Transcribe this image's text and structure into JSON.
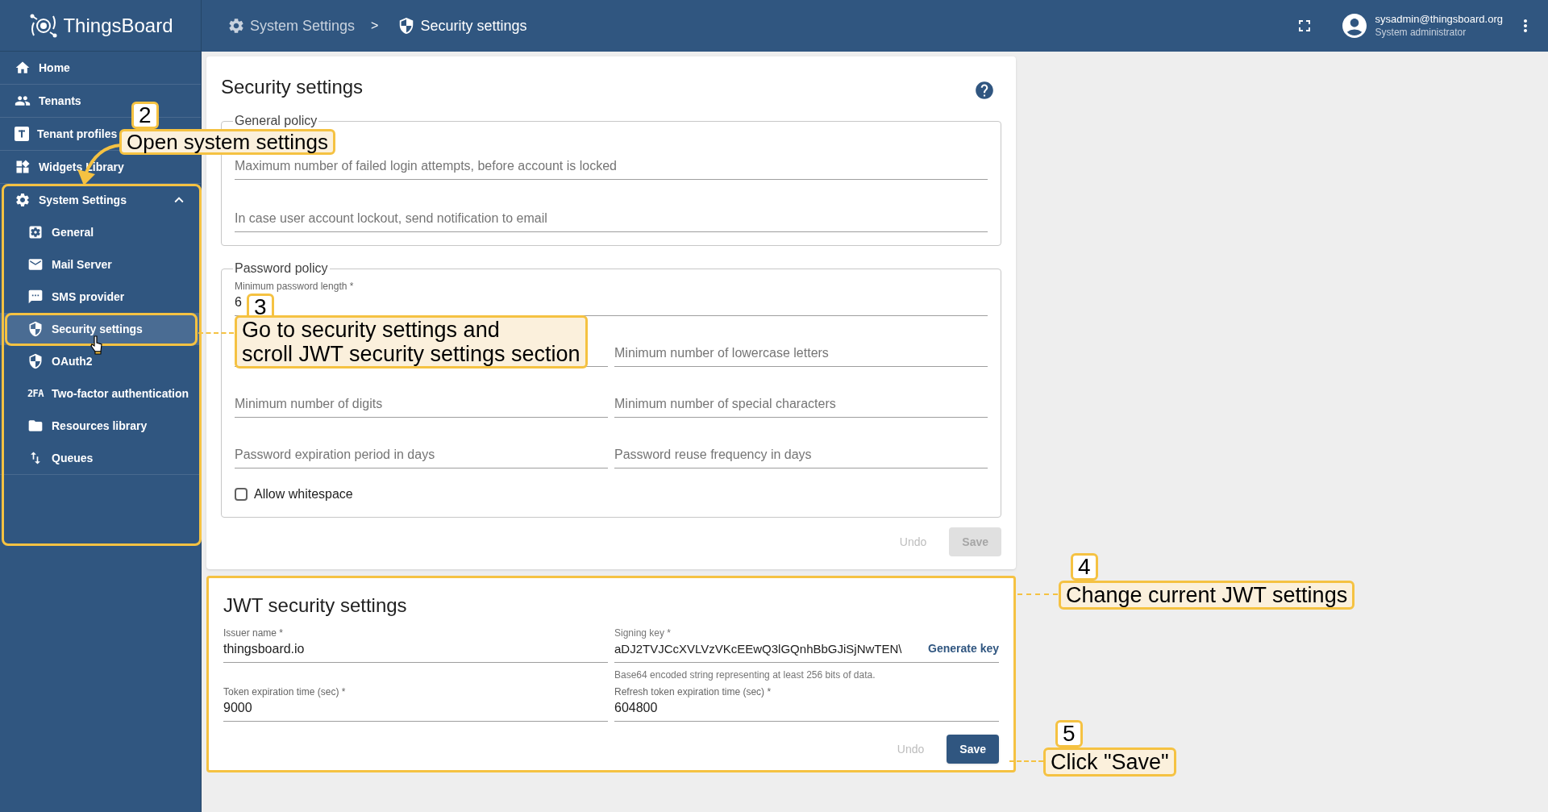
{
  "app": {
    "logo": "ThingsBoard"
  },
  "breadcrumb": {
    "parent": "System Settings",
    "separator": ">",
    "current": "Security settings"
  },
  "user": {
    "email": "sysadmin@thingsboard.org",
    "role": "System administrator"
  },
  "sidebar": {
    "items": [
      {
        "label": "Home",
        "selected": false
      },
      {
        "label": "Tenants",
        "selected": false
      },
      {
        "label": "Tenant profiles",
        "selected": false
      },
      {
        "label": "Widgets Library",
        "selected": false
      },
      {
        "label": "System Settings",
        "selected": false,
        "expanded": true,
        "children": [
          {
            "label": "General",
            "selected": false
          },
          {
            "label": "Mail Server",
            "selected": false
          },
          {
            "label": "SMS provider",
            "selected": false
          },
          {
            "label": "Security settings",
            "selected": true
          },
          {
            "label": "OAuth2",
            "selected": false
          },
          {
            "label": "Two-factor authentication",
            "selected": false,
            "icon_label": "2FA"
          },
          {
            "label": "Resources library",
            "selected": false
          },
          {
            "label": "Queues",
            "selected": false
          }
        ]
      }
    ]
  },
  "security": {
    "title": "Security settings",
    "general_policy": {
      "legend": "General policy",
      "fields": [
        {
          "placeholder": "Maximum number of failed login attempts, before account is locked"
        },
        {
          "placeholder": "In case user account lockout, send notification to email"
        }
      ]
    },
    "password_policy": {
      "legend": "Password policy",
      "length_field": {
        "label": "Minimum password length *",
        "value": "6"
      },
      "fields": [
        {
          "placeholder": "Minimum number of lowercase letters"
        },
        {
          "placeholder": "Minimum number of digits"
        },
        {
          "placeholder": "Minimum number of special characters"
        },
        {
          "placeholder": "Password expiration period in days"
        },
        {
          "placeholder": "Password reuse frequency in days"
        }
      ],
      "checkbox": {
        "label": "Allow whitespace",
        "checked": false
      }
    },
    "buttons": [
      {
        "label": "Undo",
        "kind": "text",
        "disabled": true
      },
      {
        "label": "Save",
        "kind": "raised",
        "disabled": true
      }
    ]
  },
  "jwt": {
    "title": "JWT security settings",
    "issuer": {
      "label": "Issuer name *",
      "value": "thingsboard.io"
    },
    "signing_key": {
      "label": "Signing key *",
      "value": "aDJ2TVJCcXVLVzVKcEEwQ3lGQnhBbGJiSjNwTEN\\",
      "action": "Generate key",
      "hint": "Base64 encoded string representing at least 256 bits of data."
    },
    "token_expiration": {
      "label": "Token expiration time (sec) *",
      "value": "9000"
    },
    "refresh_expiration": {
      "label": "Refresh token expiration time (sec) *",
      "value": "604800"
    },
    "buttons": [
      {
        "label": "Undo",
        "kind": "text",
        "disabled": true
      },
      {
        "label": "Save",
        "kind": "raised",
        "disabled": false
      }
    ]
  },
  "annotations": [
    {
      "number": "2",
      "text": "Open system settings"
    },
    {
      "number": "3",
      "text": "Go to security settings and\nscroll JWT security settings section"
    },
    {
      "number": "4",
      "text": "Change current JWT settings"
    },
    {
      "number": "5",
      "text": "Click \"Save\""
    }
  ]
}
